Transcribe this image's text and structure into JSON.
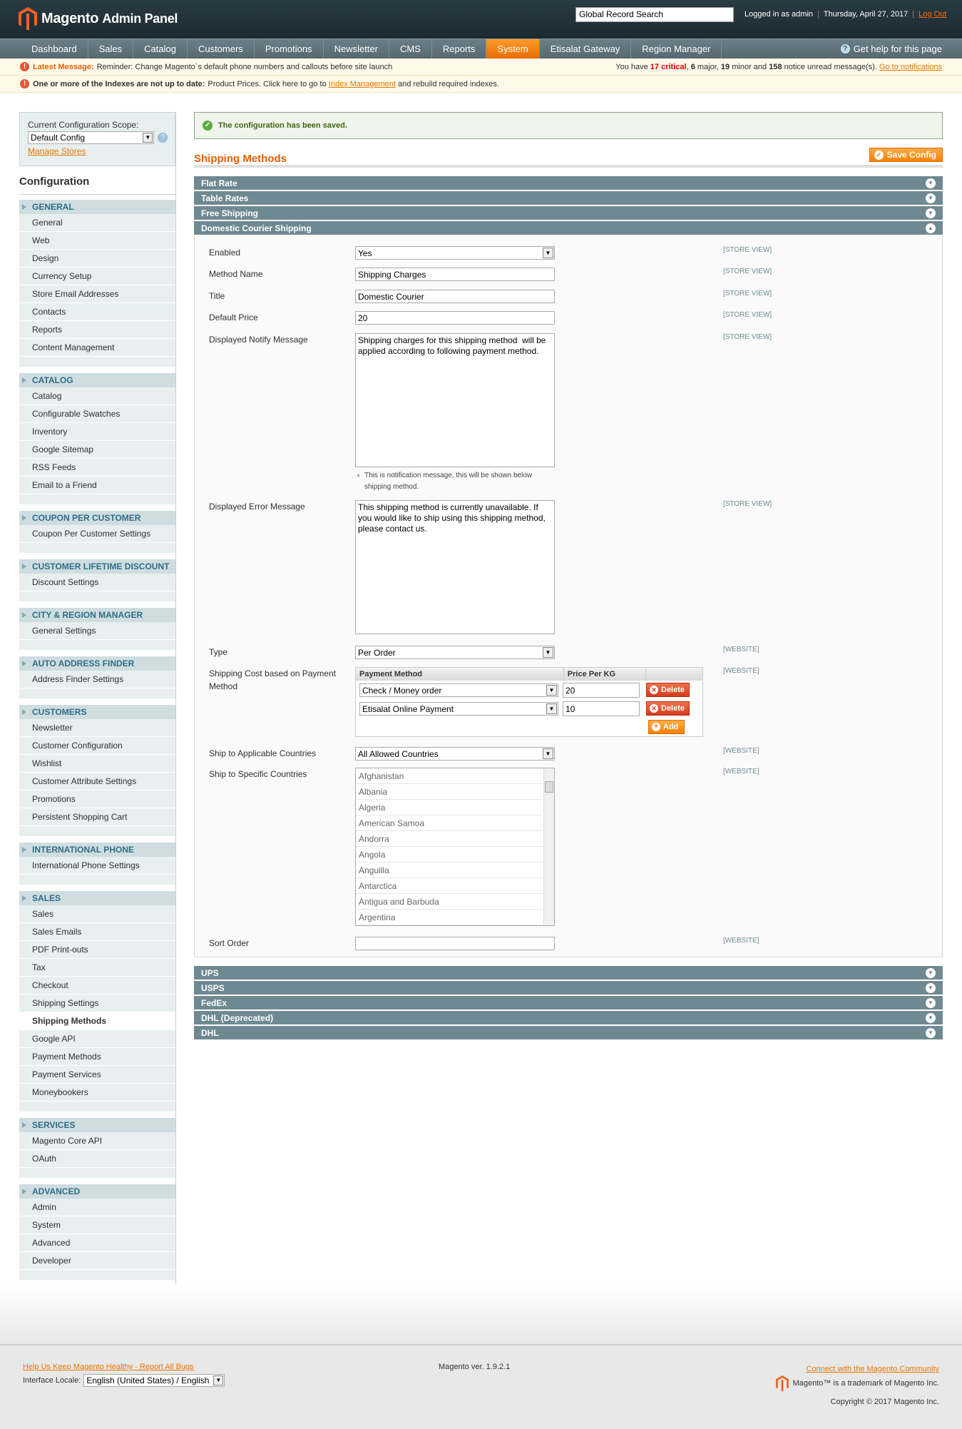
{
  "header": {
    "logo_text": "Magento",
    "logo_sub": "Admin Panel",
    "search_value": "Global Record Search",
    "logged_in": "Logged in as admin",
    "date": "Thursday, April 27, 2017",
    "logout": "Log Out"
  },
  "nav": {
    "items": [
      "Dashboard",
      "Sales",
      "Catalog",
      "Customers",
      "Promotions",
      "Newsletter",
      "CMS",
      "Reports",
      "System",
      "Etisalat Gateway",
      "Region Manager"
    ],
    "active": "System",
    "help": "Get help for this page"
  },
  "notices": {
    "latest_label": "Latest Message:",
    "latest_text": "Reminder: Change Magento`s default phone numbers and callouts before site launch",
    "summary_pre": "You have",
    "critical": "17 critical",
    "major_pre": ",",
    "major": "6",
    "major_label": "major,",
    "minor": "19",
    "minor_label": "minor and",
    "notice_count": "158",
    "notice_label": "notice unread message(s).",
    "go_link": "Go to notifications",
    "index_bold": "One or more of the Indexes are not up to date:",
    "index_text": "Product Prices. Click here to go to",
    "index_link": "Index Management",
    "index_tail": "and rebuild required indexes."
  },
  "sidebar": {
    "scope_label": "Current Configuration Scope:",
    "scope_value": "Default Config",
    "manage_stores": "Manage Stores",
    "title": "Configuration",
    "groups": [
      {
        "title": "GENERAL",
        "items": [
          "General",
          "Web",
          "Design",
          "Currency Setup",
          "Store Email Addresses",
          "Contacts",
          "Reports",
          "Content Management"
        ]
      },
      {
        "title": "CATALOG",
        "items": [
          "Catalog",
          "Configurable Swatches",
          "Inventory",
          "Google Sitemap",
          "RSS Feeds",
          "Email to a Friend"
        ]
      },
      {
        "title": "COUPON PER CUSTOMER",
        "items": [
          "Coupon Per Customer Settings"
        ]
      },
      {
        "title": "CUSTOMER LIFETIME DISCOUNT",
        "items": [
          "Discount Settings"
        ]
      },
      {
        "title": "CITY & REGION MANAGER",
        "items": [
          "General Settings"
        ]
      },
      {
        "title": "AUTO ADDRESS FINDER",
        "items": [
          "Address Finder Settings"
        ]
      },
      {
        "title": "CUSTOMERS",
        "items": [
          "Newsletter",
          "Customer Configuration",
          "Wishlist",
          "Customer Attribute Settings",
          "Promotions",
          "Persistent Shopping Cart"
        ]
      },
      {
        "title": "INTERNATIONAL PHONE",
        "items": [
          "International Phone Settings"
        ]
      },
      {
        "title": "SALES",
        "items": [
          "Sales",
          "Sales Emails",
          "PDF Print-outs",
          "Tax",
          "Checkout",
          "Shipping Settings",
          "Shipping Methods",
          "Google API",
          "Payment Methods",
          "Payment Services",
          "Moneybookers"
        ]
      },
      {
        "title": "SERVICES",
        "items": [
          "Magento Core API",
          "OAuth"
        ]
      },
      {
        "title": "ADVANCED",
        "items": [
          "Admin",
          "System",
          "Advanced",
          "Developer"
        ]
      }
    ],
    "active_item": "Shipping Methods"
  },
  "main": {
    "success_message": "The configuration has been saved.",
    "page_title": "Shipping Methods",
    "save_button": "Save Config",
    "collapsed_top": [
      "Flat Rate",
      "Table Rates",
      "Free Shipping"
    ],
    "open_section": "Domestic Courier Shipping",
    "collapsed_bottom": [
      "UPS",
      "USPS",
      "FedEx",
      "DHL (Deprecated)",
      "DHL"
    ],
    "fields": {
      "enabled": {
        "label": "Enabled",
        "value": "Yes",
        "scope": "[STORE VIEW]"
      },
      "method_name": {
        "label": "Method Name",
        "value": "Shipping Charges",
        "scope": "[STORE VIEW]"
      },
      "title": {
        "label": "Title",
        "value": "Domestic Courier",
        "scope": "[STORE VIEW]"
      },
      "default_price": {
        "label": "Default Price",
        "value": "20",
        "scope": "[STORE VIEW]"
      },
      "notify": {
        "label": "Displayed Notify Message",
        "value": "Shipping charges for this shipping method  will be applied according to following payment method.",
        "scope": "[STORE VIEW]",
        "note": "This is notification message, this will be shown below shipping method."
      },
      "error": {
        "label": "Displayed Error Message",
        "value": "This shipping method is currently unavailable. If you would like to ship using this shipping method, please contact us.",
        "scope": "[STORE VIEW]"
      },
      "type": {
        "label": "Type",
        "value": "Per Order",
        "scope": "[WEBSITE]"
      },
      "cost": {
        "label": "Shipping Cost based on Payment Method",
        "scope": "[WEBSITE]",
        "col_method": "Payment Method",
        "col_price": "Price Per KG",
        "rows": [
          {
            "method": "Check / Money order",
            "price": "20"
          },
          {
            "method": "Etisalat Online Payment",
            "price": "10"
          }
        ],
        "delete_label": "Delete",
        "add_label": "Add"
      },
      "applicable": {
        "label": "Ship to Applicable Countries",
        "value": "All Allowed Countries",
        "scope": "[WEBSITE]"
      },
      "specific": {
        "label": "Ship to Specific Countries",
        "scope": "[WEBSITE]",
        "options": [
          "Afghanistan",
          "Albania",
          "Algeria",
          "American Samoa",
          "Andorra",
          "Angola",
          "Anguilla",
          "Antarctica",
          "Antigua and Barbuda",
          "Argentina"
        ]
      },
      "sort_order": {
        "label": "Sort Order",
        "value": "",
        "scope": "[WEBSITE]"
      }
    }
  },
  "footer": {
    "bug_link": "Help Us Keep Magento Healthy - Report All Bugs",
    "locale_label": "Interface Locale:",
    "locale_value": "English (United States) / English",
    "version": "Magento ver. 1.9.2.1",
    "community_link": "Connect with the Magento Community",
    "trademark": "Magento™ is a trademark of Magento Inc.",
    "copyright": "Copyright © 2017 Magento Inc."
  },
  "colors": {
    "accent": "#eb5e00",
    "nav": "#566870",
    "section": "#6f8992",
    "success": "#3d6611"
  }
}
